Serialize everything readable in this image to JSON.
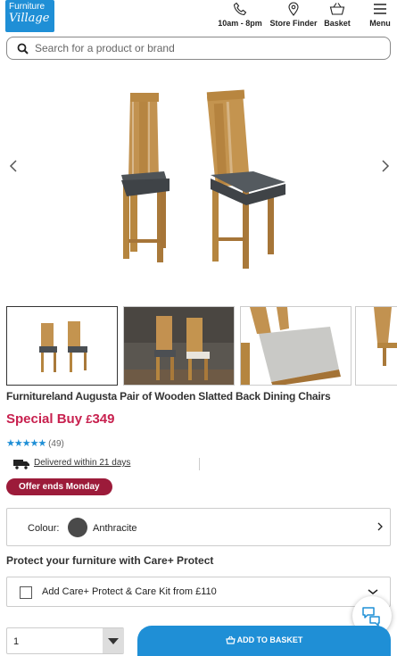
{
  "header": {
    "logo_line1": "Furniture",
    "logo_line2": "Village",
    "phone_hours": "10am - 8pm",
    "store_finder": "Store Finder",
    "basket": "Basket",
    "menu": "Menu"
  },
  "search": {
    "placeholder": "Search for a product or brand"
  },
  "product": {
    "title": "Furnitureland Augusta Pair of Wooden Slatted Back Dining Chairs",
    "price_label": "Special Buy",
    "price_currency": "£",
    "price_value": "349",
    "rating_stars": "★★★★★",
    "rating_count": "(49)",
    "delivery": "Delivered within 21 days",
    "offer": "Offer ends Monday"
  },
  "colour": {
    "label": "Colour:",
    "value": "Anthracite",
    "swatch": "#4a4a4a"
  },
  "protect": {
    "title": "Protect your furniture with Care+ Protect",
    "option": "Add Care+ Protect & Care Kit from £110"
  },
  "purchase": {
    "quantity": "1",
    "add_label": "ADD TO BASKET"
  },
  "colors": {
    "brand_blue": "#1f8fd6",
    "price_red": "#c8214f",
    "offer_bg": "#9c1b3a"
  }
}
